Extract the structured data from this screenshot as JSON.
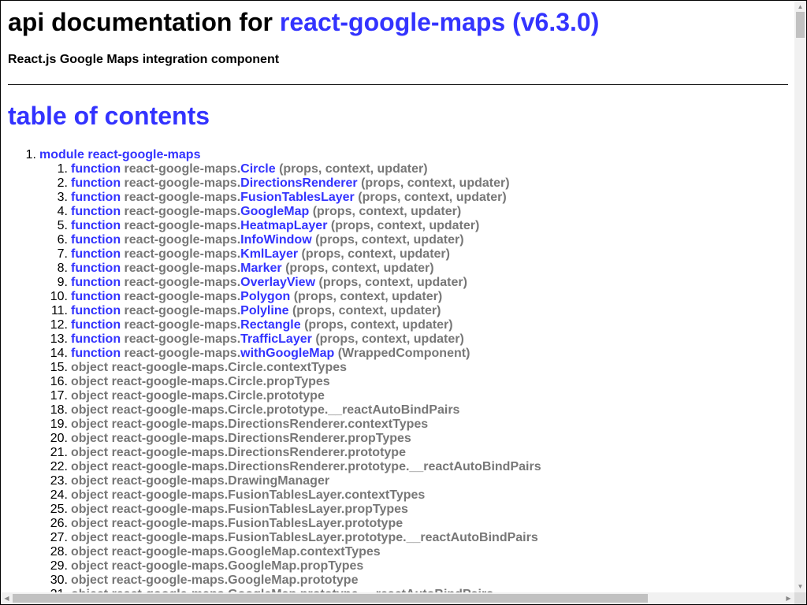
{
  "header": {
    "title_prefix": "api documentation for ",
    "title_link": "react-google-maps (v6.3.0)",
    "subtitle": "React.js Google Maps integration component"
  },
  "toc": {
    "heading": "table of contents",
    "module": {
      "number": "1.",
      "label": "module react-google-maps"
    },
    "functions": [
      {
        "name": "Circle",
        "args": "(props, context, updater)"
      },
      {
        "name": "DirectionsRenderer",
        "args": "(props, context, updater)"
      },
      {
        "name": "FusionTablesLayer",
        "args": "(props, context, updater)"
      },
      {
        "name": "GoogleMap",
        "args": "(props, context, updater)"
      },
      {
        "name": "HeatmapLayer",
        "args": "(props, context, updater)"
      },
      {
        "name": "InfoWindow",
        "args": "(props, context, updater)"
      },
      {
        "name": "KmlLayer",
        "args": "(props, context, updater)"
      },
      {
        "name": "Marker",
        "args": "(props, context, updater)"
      },
      {
        "name": "OverlayView",
        "args": "(props, context, updater)"
      },
      {
        "name": "Polygon",
        "args": "(props, context, updater)"
      },
      {
        "name": "Polyline",
        "args": "(props, context, updater)"
      },
      {
        "name": "Rectangle",
        "args": "(props, context, updater)"
      },
      {
        "name": "TrafficLayer",
        "args": "(props, context, updater)"
      },
      {
        "name": "withGoogleMap",
        "args": "(WrappedComponent)"
      }
    ],
    "function_keyword": "function",
    "namespace": "react-google-maps.",
    "objects": [
      "object react-google-maps.Circle.contextTypes",
      "object react-google-maps.Circle.propTypes",
      "object react-google-maps.Circle.prototype",
      "object react-google-maps.Circle.prototype.__reactAutoBindPairs",
      "object react-google-maps.DirectionsRenderer.contextTypes",
      "object react-google-maps.DirectionsRenderer.propTypes",
      "object react-google-maps.DirectionsRenderer.prototype",
      "object react-google-maps.DirectionsRenderer.prototype.__reactAutoBindPairs",
      "object react-google-maps.DrawingManager",
      "object react-google-maps.FusionTablesLayer.contextTypes",
      "object react-google-maps.FusionTablesLayer.propTypes",
      "object react-google-maps.FusionTablesLayer.prototype",
      "object react-google-maps.FusionTablesLayer.prototype.__reactAutoBindPairs",
      "object react-google-maps.GoogleMap.contextTypes",
      "object react-google-maps.GoogleMap.propTypes",
      "object react-google-maps.GoogleMap.prototype",
      "object react-google-maps.GoogleMap.prototype.__reactAutoBindPairs"
    ]
  },
  "scrollbars": {
    "up": "▲",
    "down": "▼",
    "left": "◀",
    "right": "▶"
  }
}
